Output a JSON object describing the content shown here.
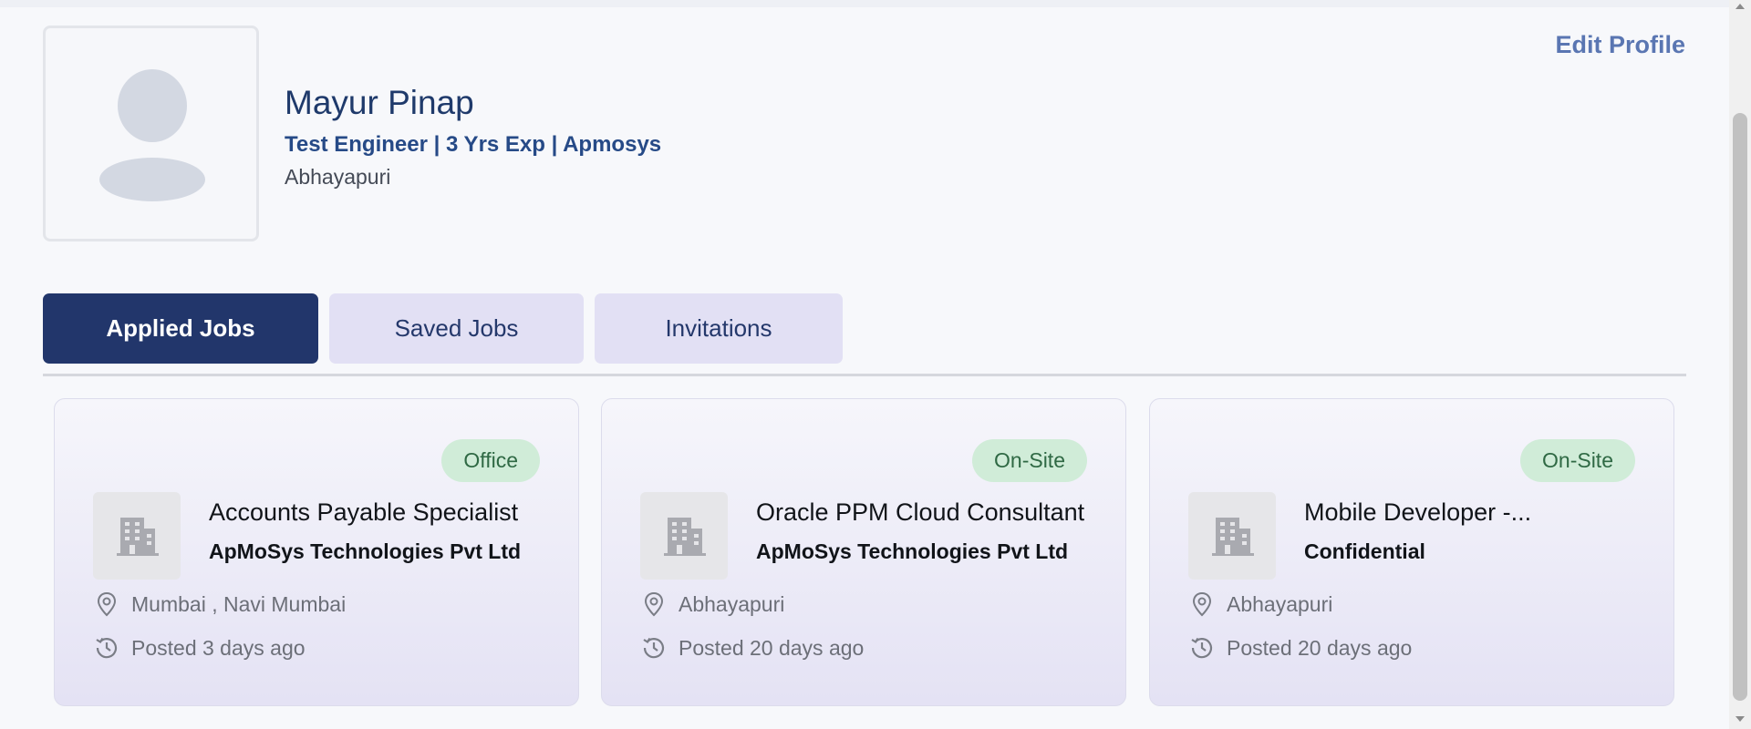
{
  "profile": {
    "name": "Mayur Pinap",
    "subtitle": "Test Engineer | 3 Yrs Exp | Apmosys",
    "location": "Abhayapuri",
    "edit_label": "Edit Profile"
  },
  "tabs": [
    {
      "label": "Applied Jobs",
      "active": true
    },
    {
      "label": "Saved Jobs",
      "active": false
    },
    {
      "label": "Invitations",
      "active": false
    }
  ],
  "jobs": [
    {
      "badge": "Office",
      "title": "Accounts Payable Specialist",
      "company": "ApMoSys Technologies Pvt Ltd",
      "location": "Mumbai , Navi Mumbai",
      "posted": "Posted 3 days ago"
    },
    {
      "badge": "On-Site",
      "title": "Oracle PPM Cloud Consultant",
      "company": "ApMoSys Technologies Pvt Ltd",
      "location": "Abhayapuri",
      "posted": "Posted 20 days ago"
    },
    {
      "badge": "On-Site",
      "title": "Mobile Developer -...",
      "company": "Confidential",
      "location": "Abhayapuri",
      "posted": "Posted 20 days ago"
    }
  ],
  "icons": {
    "avatar": "user-placeholder-icon",
    "company": "building-icon",
    "location": "location-pin-icon",
    "posted": "history-clock-icon"
  },
  "colors": {
    "primary": "#22366b",
    "tab_inactive": "#e2e0f4",
    "badge_bg": "#d0ecd8",
    "badge_text": "#2f6944",
    "link": "#5a76b2"
  }
}
